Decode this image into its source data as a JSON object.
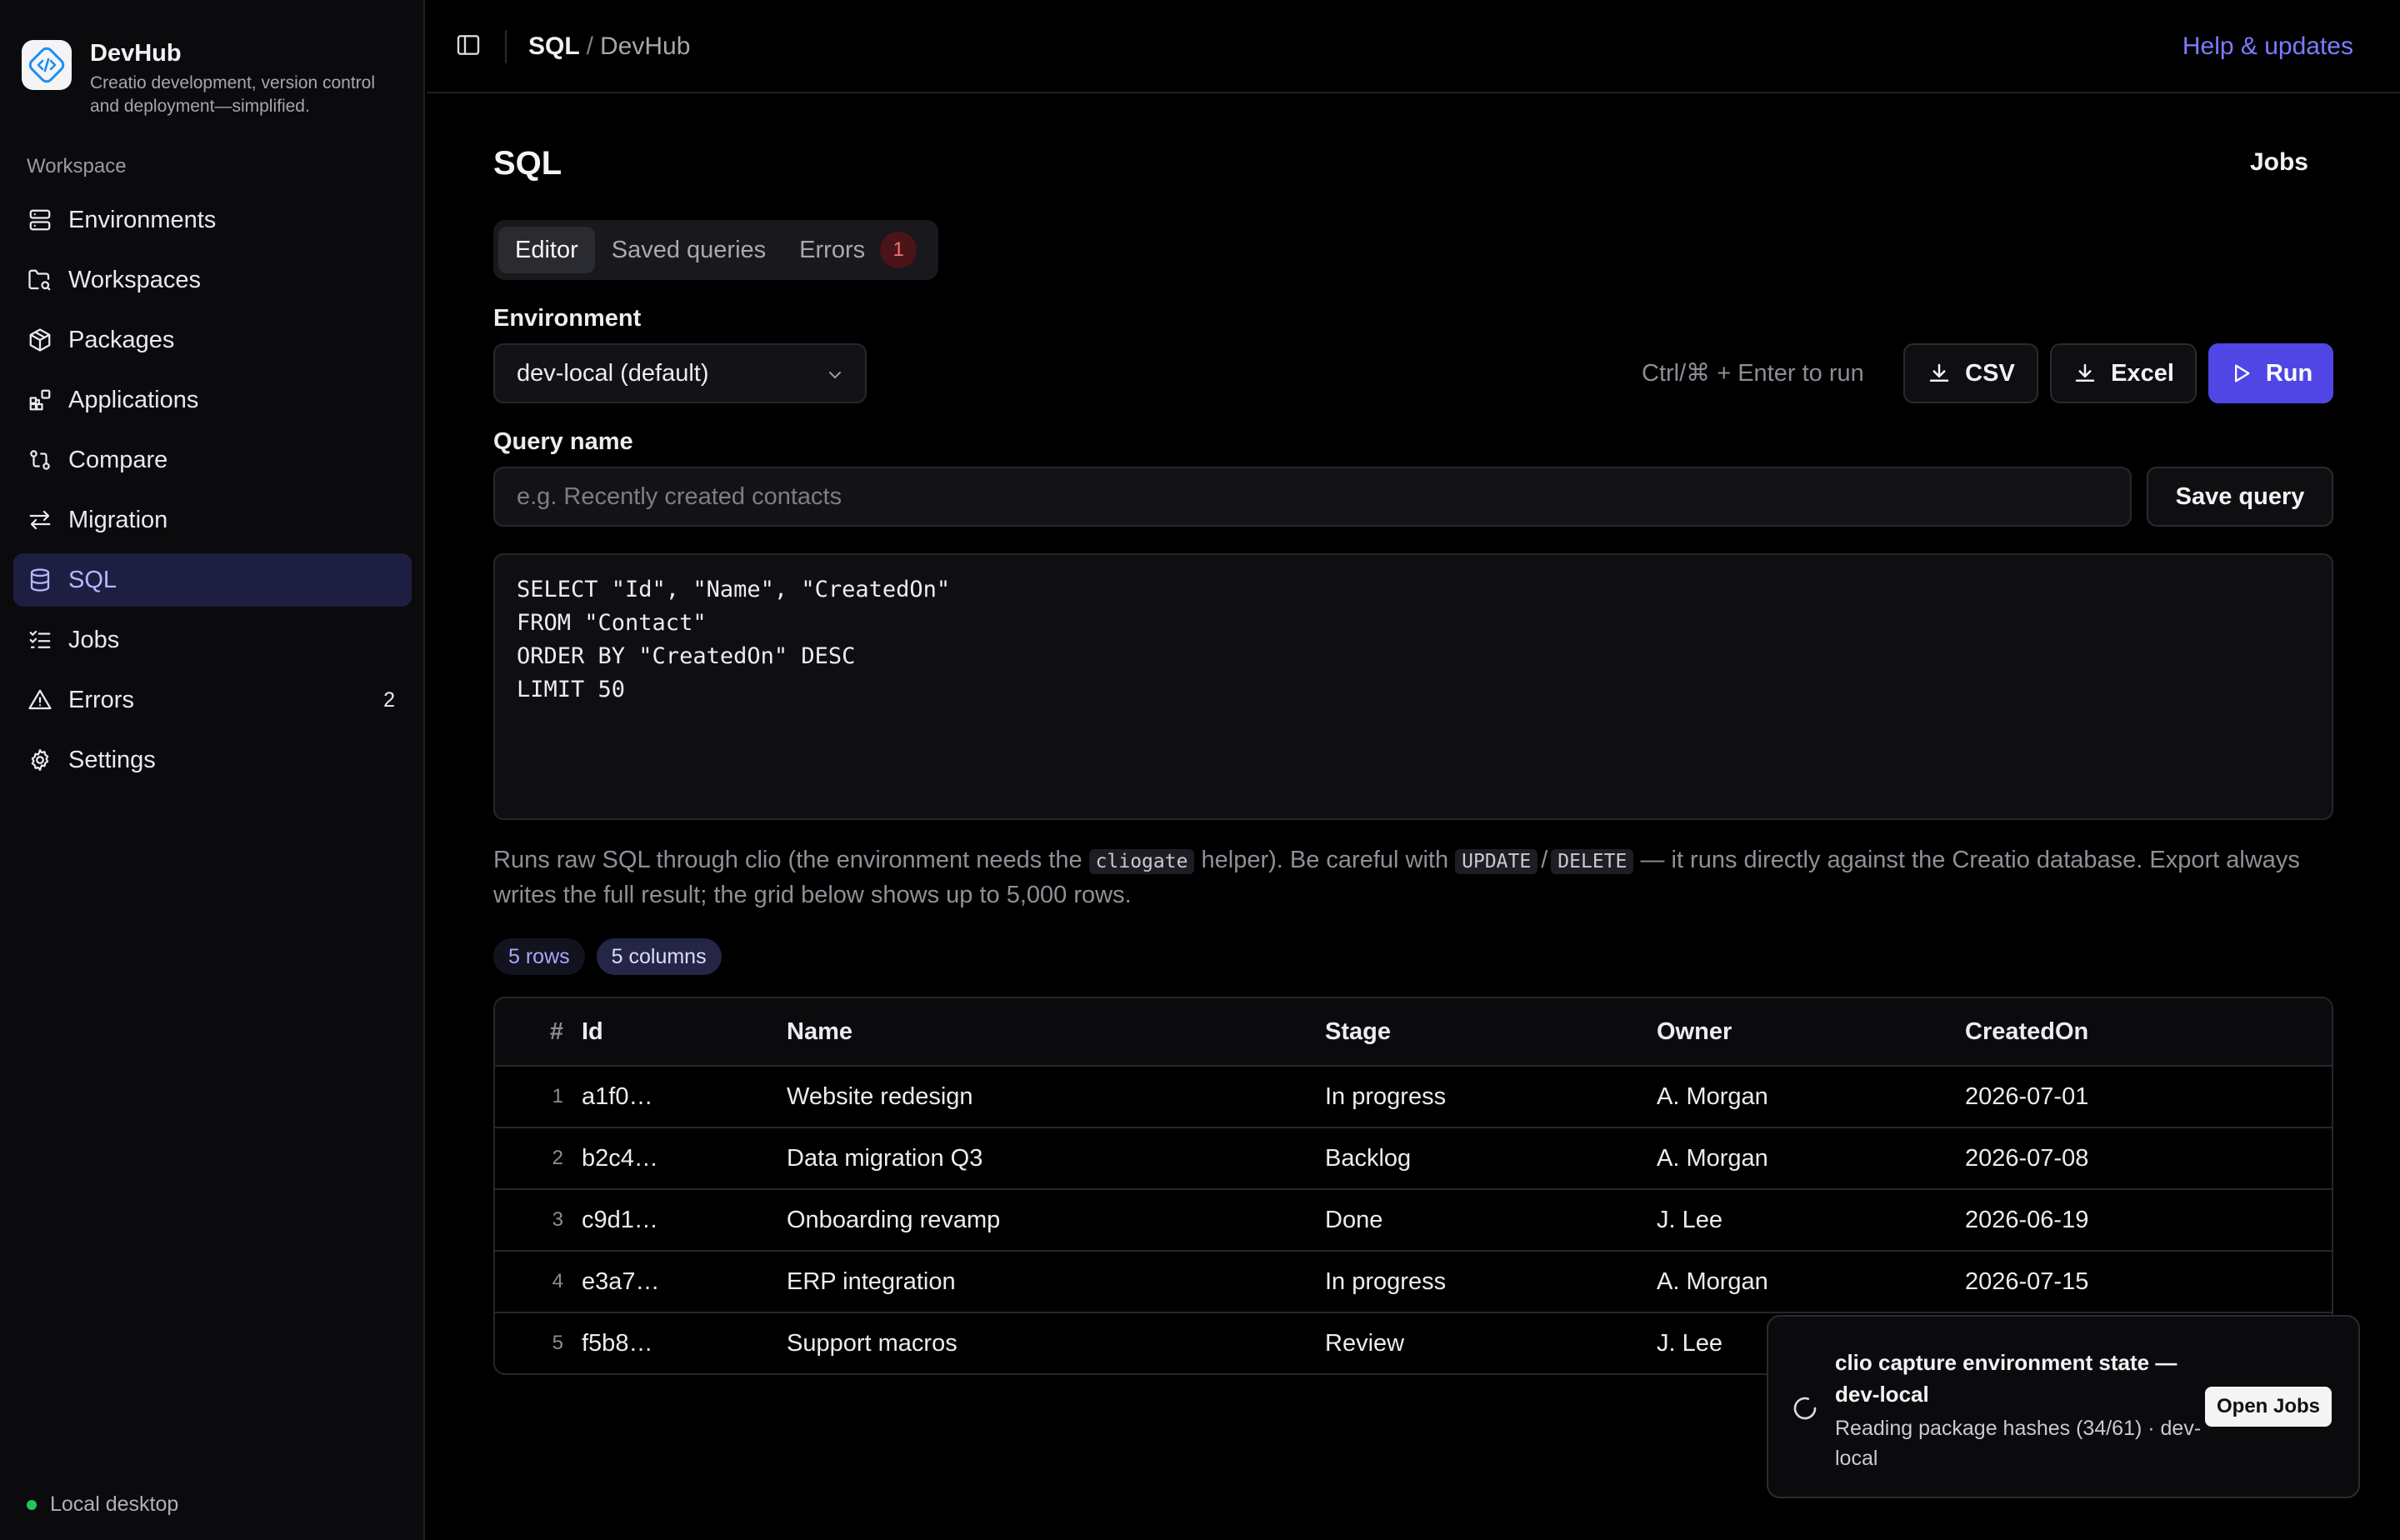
{
  "app": {
    "name": "DevHub",
    "tagline": "Creatio development, version control and deployment—simplified."
  },
  "sidebar": {
    "section_label": "Workspace",
    "items": [
      {
        "label": "Environments",
        "icon": "server-icon"
      },
      {
        "label": "Workspaces",
        "icon": "folder-search-icon"
      },
      {
        "label": "Packages",
        "icon": "package-icon"
      },
      {
        "label": "Applications",
        "icon": "blocks-icon"
      },
      {
        "label": "Compare",
        "icon": "git-compare-icon"
      },
      {
        "label": "Migration",
        "icon": "arrows-left-right-icon"
      },
      {
        "label": "SQL",
        "icon": "database-icon",
        "active": true
      },
      {
        "label": "Jobs",
        "icon": "list-checks-icon"
      },
      {
        "label": "Errors",
        "icon": "alert-triangle-icon",
        "badge": "2"
      },
      {
        "label": "Settings",
        "icon": "gear-icon"
      }
    ],
    "footer_status": "Local desktop"
  },
  "topbar": {
    "breadcrumb_current": "SQL",
    "breadcrumb_separator": "/",
    "breadcrumb_parent": "DevHub",
    "help_link": "Help & updates"
  },
  "page": {
    "title": "SQL",
    "jobs_link": "Jobs",
    "tabs": [
      {
        "label": "Editor",
        "active": true
      },
      {
        "label": "Saved queries"
      },
      {
        "label": "Errors",
        "count": "1"
      }
    ]
  },
  "form": {
    "environment_label": "Environment",
    "environment_value": "dev-local (default)",
    "shortcut_hint": "Ctrl/⌘ + Enter to run",
    "csv_label": "CSV",
    "excel_label": "Excel",
    "run_label": "Run",
    "query_name_label": "Query name",
    "query_name_placeholder": "e.g. Recently created contacts",
    "query_name_value": "",
    "save_label": "Save query",
    "sql": "SELECT \"Id\", \"Name\", \"CreatedOn\"\nFROM \"Contact\"\nORDER BY \"CreatedOn\" DESC\nLIMIT 50"
  },
  "note": {
    "part1": "Runs raw SQL through clio (the environment needs the ",
    "code1": "cliogate",
    "part2": " helper). Be careful with ",
    "code2": "UPDATE",
    "sep": "/",
    "code3": "DELETE",
    "part3": " — it runs directly against the Creatio database. Export always writes the full result; the grid below shows up to 5,000 rows."
  },
  "result": {
    "rows_pill": "5 rows",
    "cols_pill": "5 columns",
    "columns": [
      "#",
      "Id",
      "Name",
      "Stage",
      "Owner",
      "CreatedOn"
    ],
    "rows": [
      {
        "n": "1",
        "id": "a1f0…",
        "name": "Website redesign",
        "stage": "In progress",
        "owner": "A. Morgan",
        "created": "2026-07-01"
      },
      {
        "n": "2",
        "id": "b2c4…",
        "name": "Data migration Q3",
        "stage": "Backlog",
        "owner": "A. Morgan",
        "created": "2026-07-08"
      },
      {
        "n": "3",
        "id": "c9d1…",
        "name": "Onboarding revamp",
        "stage": "Done",
        "owner": "J. Lee",
        "created": "2026-06-19"
      },
      {
        "n": "4",
        "id": "e3a7…",
        "name": "ERP integration",
        "stage": "In progress",
        "owner": "A. Morgan",
        "created": "2026-07-15"
      },
      {
        "n": "5",
        "id": "f5b8…",
        "name": "Support macros",
        "stage": "Review",
        "owner": "J. Lee",
        "created": ""
      }
    ]
  },
  "toast": {
    "title": "clio capture environment state — dev-local",
    "body": "Reading package hashes (34/61) · dev-local",
    "action": "Open Jobs"
  },
  "colors": {
    "accent": "#4f46e5",
    "link": "#7c7bff",
    "active_nav_bg": "#1e1e42",
    "error_badge": "#f87171",
    "online_dot": "#22c55e"
  }
}
